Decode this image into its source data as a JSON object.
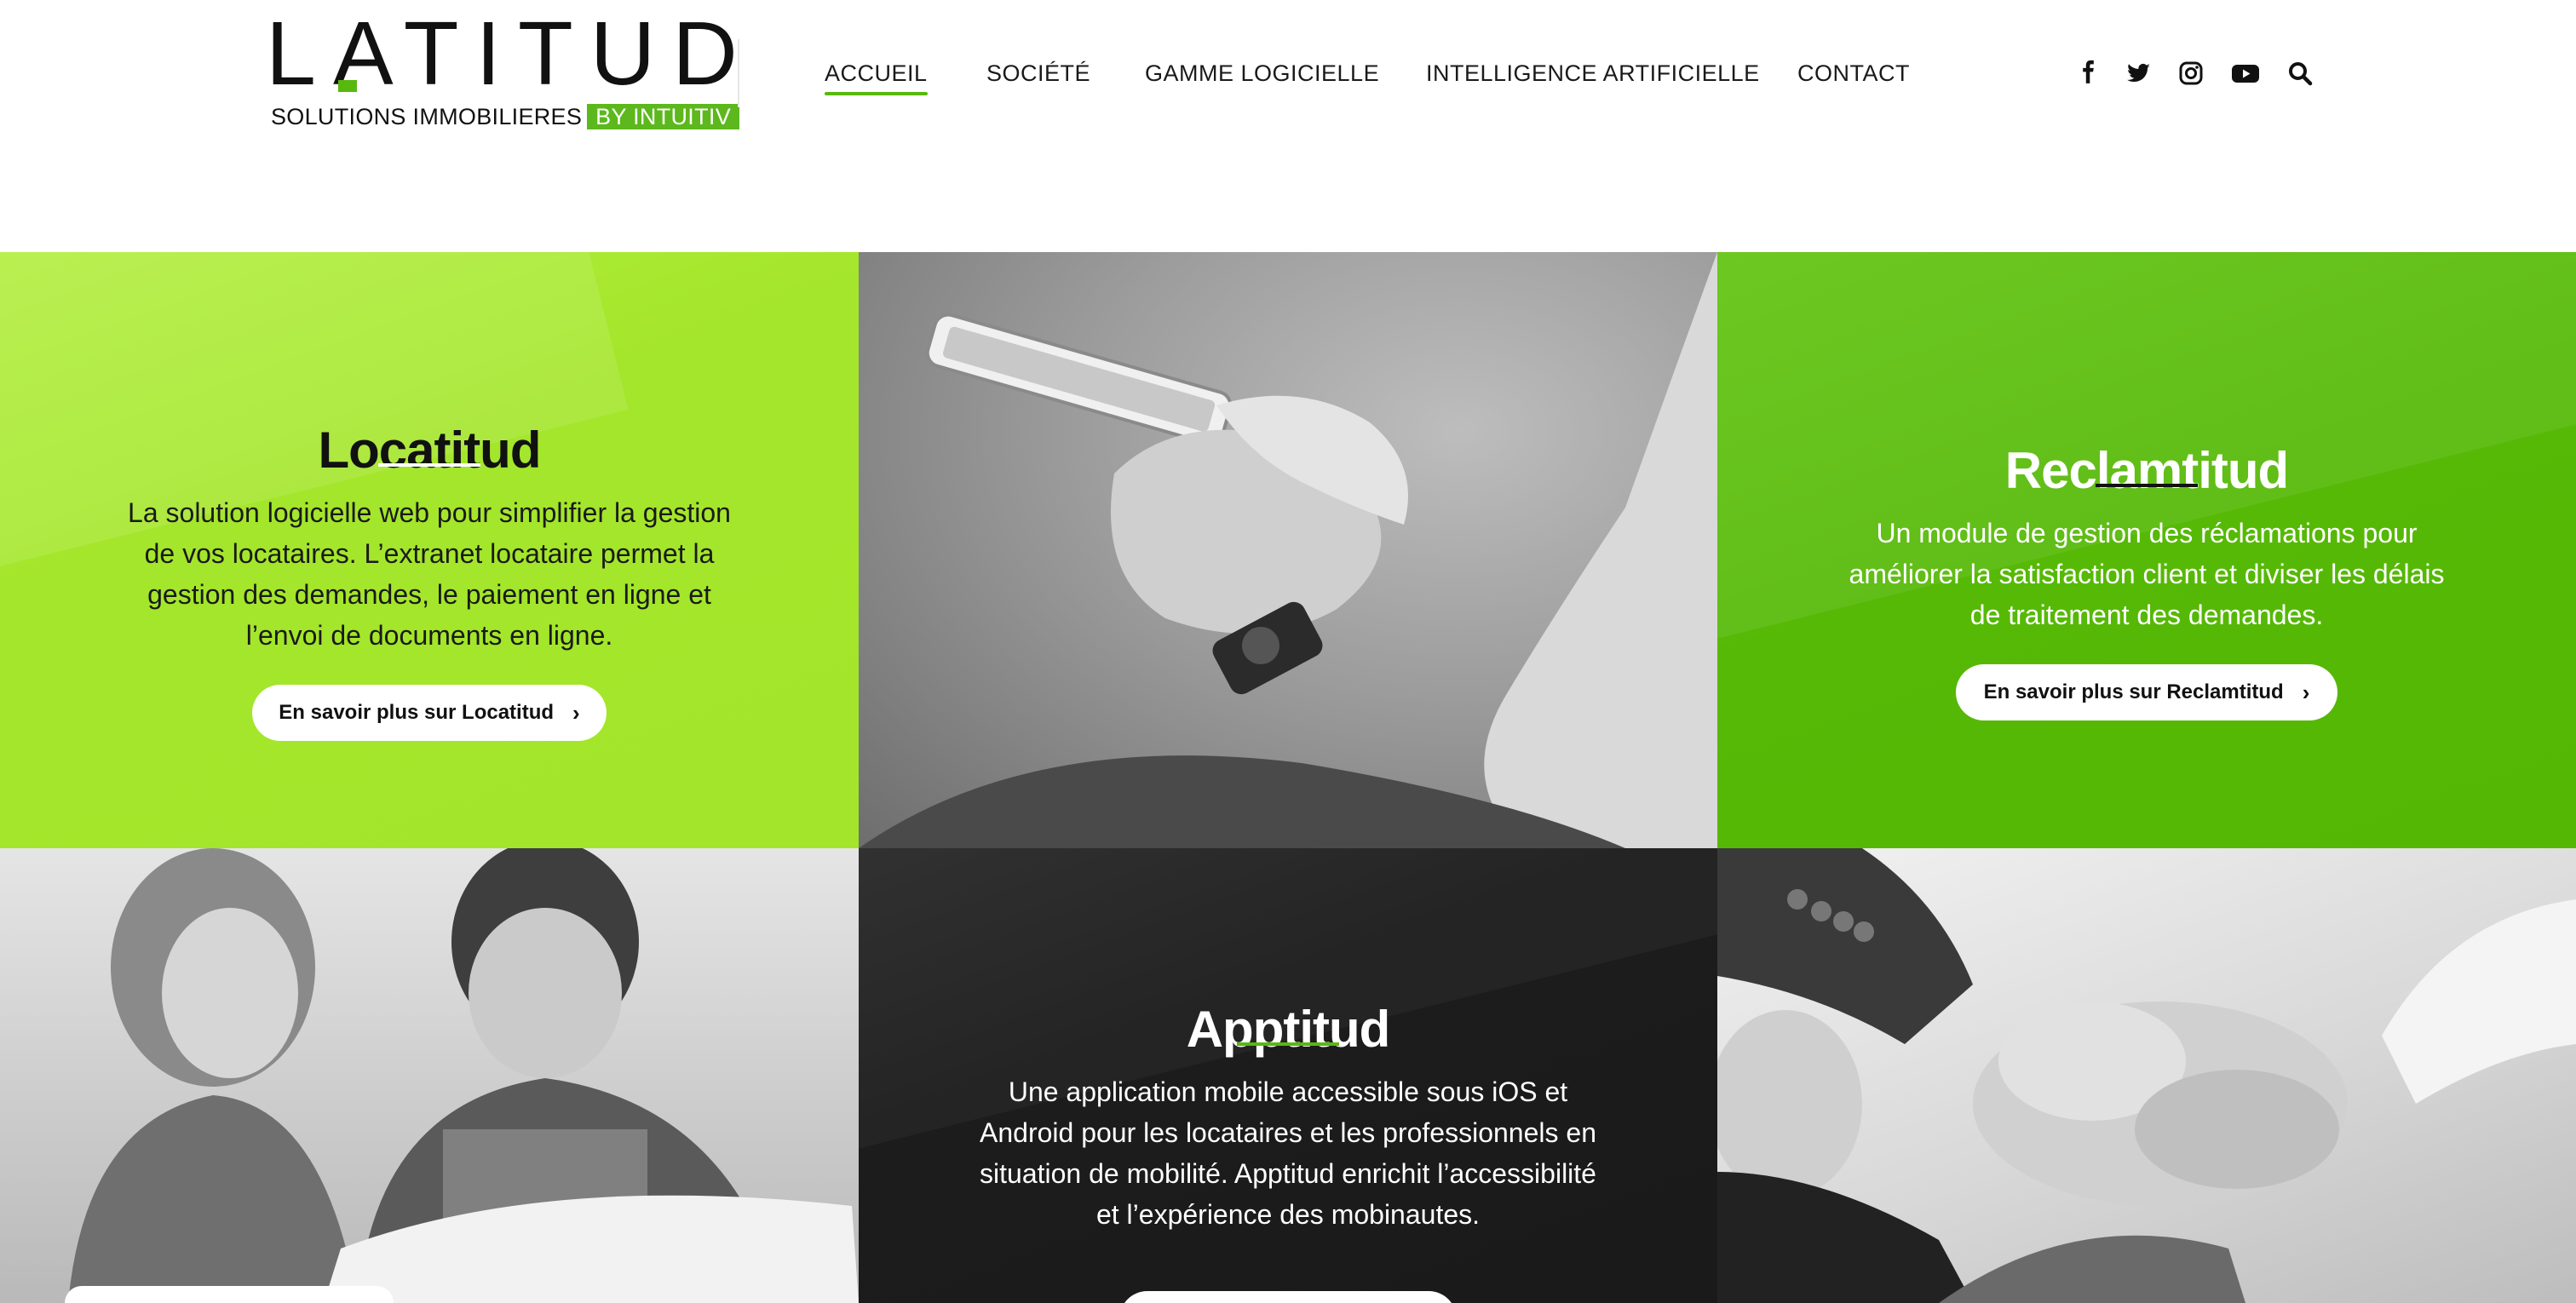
{
  "brand": {
    "logo_text": "LATITUD",
    "tagline": "SOLUTIONS IMMOBILIERES",
    "tagline_badge": "BY INTUITIV",
    "accent_color": "#58b80e"
  },
  "nav": {
    "items": [
      {
        "label": "ACCUEIL",
        "active": true
      },
      {
        "label": "SOCIÉTÉ",
        "active": false
      },
      {
        "label": "GAMME LOGICIELLE",
        "active": false
      },
      {
        "label": "INTELLIGENCE ARTIFICIELLE",
        "active": false
      },
      {
        "label": "CONTACT",
        "active": false
      }
    ]
  },
  "social": {
    "icons": [
      "facebook-icon",
      "twitter-icon",
      "instagram-icon",
      "youtube-icon",
      "search-icon"
    ]
  },
  "cards": {
    "locatitud": {
      "title": "Locatitud",
      "text": "La solution logicielle web pour simplifier la gestion de vos locataires. L’extranet locataire permet la gestion des demandes, le paiement en ligne et l’envoi de documents en ligne.",
      "button": "En savoir plus sur Locatitud",
      "bg_color": "#a4e62b"
    },
    "reclamtitud": {
      "title": "Reclamtitud",
      "text": "Un module de gestion des réclamations pour améliorer la satisfaction client et diviser les délais de traitement des demandes.",
      "button": "En savoir plus sur Reclamtitud",
      "bg_color": "#56b906"
    },
    "apptitud": {
      "title": "Apptitud",
      "text": "Une application mobile accessible sous iOS et Android pour les locataires et les professionnels en situation de mobilité. Apptitud enrichit l’accessibilité et l’expérience des mobinautes.",
      "bg_color": "#1c1c1c"
    }
  },
  "photos": {
    "phone_hands": "phone-hands-photo",
    "couple_plans": "couple-plans-photo",
    "team_fists": "team-fists-photo"
  }
}
